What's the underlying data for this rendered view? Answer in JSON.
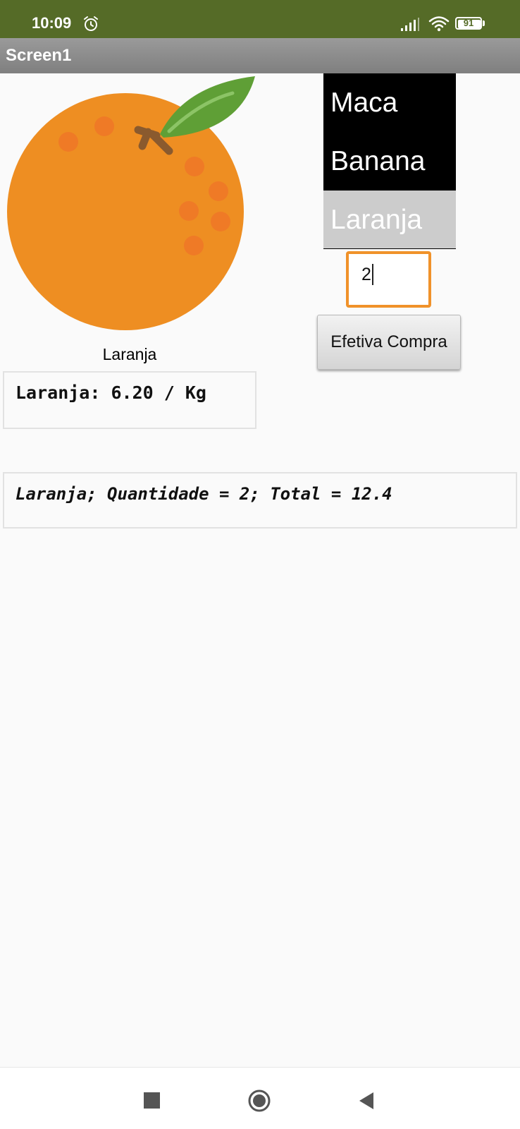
{
  "status_bar": {
    "time": "10:09",
    "battery": "91",
    "icons": [
      "alarm-icon",
      "signal-icon",
      "wifi-icon",
      "battery-icon"
    ]
  },
  "app": {
    "screen_title": "Screen1"
  },
  "fruit": {
    "image_icon": "orange-fruit-image",
    "caption": "Laranja",
    "price_text": "Laranja: 6.20 / Kg"
  },
  "fruit_list": {
    "items": [
      "Maca",
      "Banana",
      "Laranja"
    ],
    "selected": "Laranja"
  },
  "quantity": {
    "value": "2"
  },
  "purchase_button": {
    "label": "Efetiva Compra"
  },
  "result": {
    "text": "Laranja; Quantidade = 2; Total = 12.4"
  },
  "nav_bar": {
    "icons": [
      "recents-icon",
      "home-icon",
      "back-icon"
    ]
  },
  "colors": {
    "status_bar": "#556b27",
    "title_bar": "#8c8c8c",
    "list_background": "#000000",
    "list_selected": "#cccccc",
    "input_focus_border": "#f0922a",
    "orange_fruit": "#ee8e22",
    "leaf": "#5f9f36"
  }
}
